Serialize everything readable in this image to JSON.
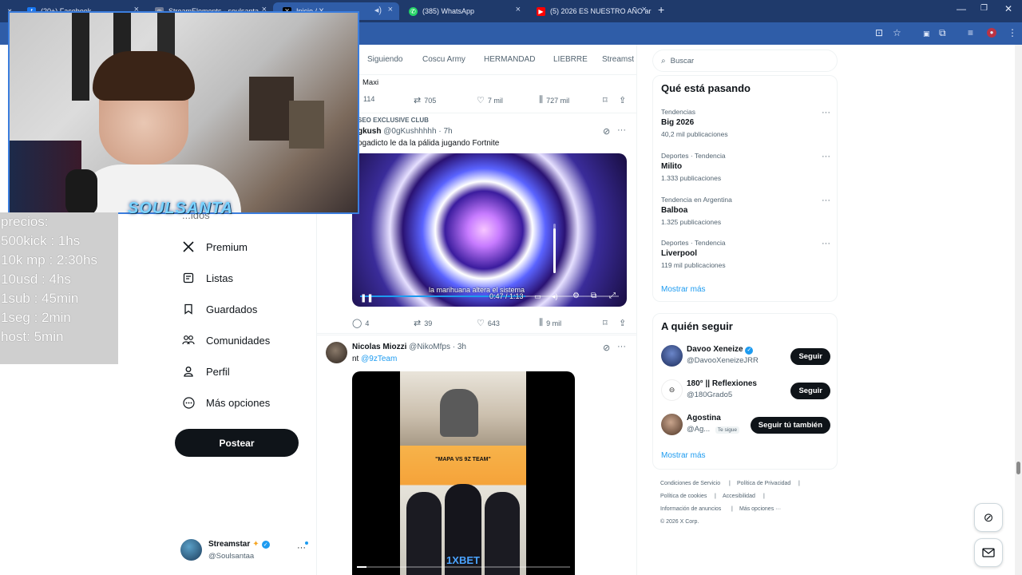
{
  "browser": {
    "tabs": [
      {
        "label": "(20+) Facebook",
        "favicon": "f",
        "color": "#1877f2"
      },
      {
        "label": "StreamElements - soulsanta",
        "favicon": "◎",
        "color": "#6f7a95"
      },
      {
        "label": "Inicio / X",
        "favicon": "X",
        "color": "#000000"
      },
      {
        "label": "(385) WhatsApp",
        "favicon": "✆",
        "color": "#25d366"
      },
      {
        "label": "(5) 2026 ES NUESTRO AÑO ar",
        "favicon": "▶",
        "color": "#ff0000"
      }
    ],
    "new_tab": "+",
    "tab_close": "×"
  },
  "overlay": {
    "logo": "SOULSANTA",
    "lines": [
      "precios:",
      "500kick : 1hs",
      "10k mp : 2:30hs",
      "10usd : 4hs",
      "1sub : 45min",
      "1seg : 2min",
      "host: 5min"
    ]
  },
  "nav": {
    "partial": "...idos",
    "items": [
      {
        "label": "Premium",
        "icon": "x-logo-icon"
      },
      {
        "label": "Listas",
        "icon": "list-icon"
      },
      {
        "label": "Guardados",
        "icon": "bookmark-icon"
      },
      {
        "label": "Comunidades",
        "icon": "communities-icon"
      },
      {
        "label": "Perfil",
        "icon": "profile-icon"
      },
      {
        "label": "Más opciones",
        "icon": "more-icon"
      }
    ],
    "post_label": "Postear",
    "account": {
      "name": "Streamstar",
      "handle": "@Soulsantaa",
      "menu": "···"
    }
  },
  "feed": {
    "tabs": [
      "Siguiendo",
      "Coscu Army",
      "HERMANDAD",
      "LIEBRRE",
      "Streamst"
    ],
    "tweet1": {
      "author_partial": "Maxi",
      "actions": {
        "replies": "114",
        "retweets": "705",
        "likes": "7 mil",
        "views": "727 mil"
      }
    },
    "tweet2": {
      "community": "SEO EXCLUSIVE CLUB",
      "name": "gkush",
      "handle": "@0gKushhhhh",
      "time": "· 7h",
      "text": "ogadicto le da la pálida jugando Fortnite",
      "video": {
        "caption": "la marihuana altera el sistema",
        "time": "0:47 / 1:13",
        "progress": 0.64,
        "volume": 0.9
      },
      "actions": {
        "replies": "4",
        "retweets": "39",
        "likes": "643",
        "views": "9 mil"
      }
    },
    "tweet3": {
      "name": "Nicolas Miozzi",
      "handle": "@NikoMfps",
      "time": "· 3h",
      "text_prefix": "nt",
      "mention": "@9zTeam",
      "video": {
        "caption": "\"MAPA VS 9Z TEAM\"",
        "sponsor": "1XBET"
      }
    }
  },
  "right": {
    "search_placeholder": "Buscar",
    "trends_title": "Qué está pasando",
    "trends": [
      {
        "context": "Tendencias",
        "name": "Big 2026",
        "count": "40,2 mil publicaciones"
      },
      {
        "context": "Deportes · Tendencia",
        "name": "Milito",
        "count": "1.333 publicaciones"
      },
      {
        "context": "Tendencia en Argentina",
        "name": "Balboa",
        "count": "1.325 publicaciones"
      },
      {
        "context": "Deportes · Tendencia",
        "name": "Liverpool",
        "count": "119 mil publicaciones"
      }
    ],
    "show_more": "Mostrar más",
    "follow_title": "A quién seguir",
    "follow": [
      {
        "name": "Davoo Xeneize",
        "handle": "@DavooXeneizeJRR",
        "button": "Seguir",
        "verified": true
      },
      {
        "name": "180° || Reflexiones",
        "handle": "@180Grado5",
        "button": "Seguir",
        "verified": false
      },
      {
        "name": "Agostina",
        "handle": "@Ag...",
        "badge": "Te sigue",
        "button": "Seguir tú también",
        "verified": false
      }
    ],
    "show_more_2": "Mostrar más",
    "footer": [
      "Condiciones de Servicio",
      "|",
      "Política de Privacidad",
      "|",
      "Política de cookies",
      "|",
      "Accesibilidad",
      "|",
      "Información de anuncios",
      "|",
      "Más opciones ···",
      "© 2026 X Corp."
    ]
  },
  "colors": {
    "accent": "#1d9bf0",
    "dark": "#0f1419",
    "muted": "#536471"
  }
}
